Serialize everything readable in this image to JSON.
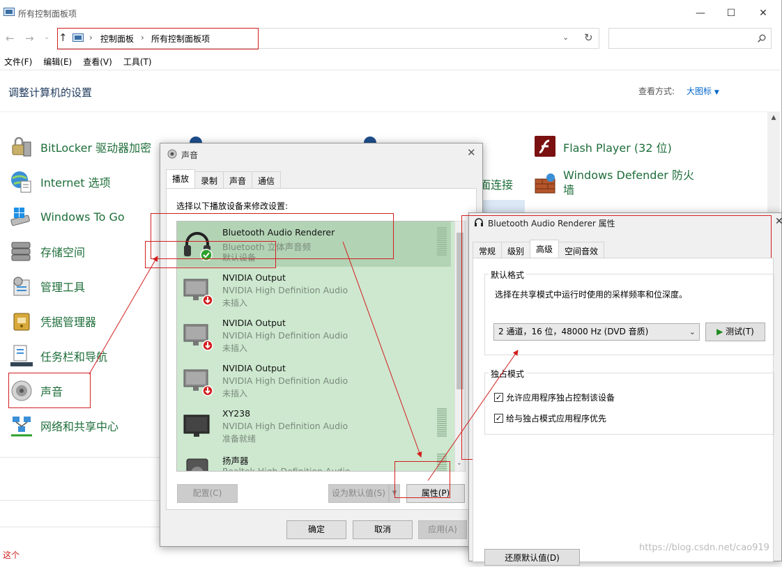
{
  "control_panel": {
    "window_title": "所有控制面板项",
    "breadcrumb": [
      "控制面板",
      "所有控制面板项"
    ],
    "menu": [
      "文件(F)",
      "编辑(E)",
      "查看(V)",
      "工具(T)"
    ],
    "heading": "调整计算机的设置",
    "view_by_label": "查看方式:",
    "view_by_value": "大图标",
    "items_left": [
      {
        "label": "BitLocker 驱动器加密",
        "icon": "bitlocker-icon"
      },
      {
        "label": "Internet 选项",
        "icon": "internet-options-icon"
      },
      {
        "label": "Windows To Go",
        "icon": "windows-to-go-icon"
      },
      {
        "label": "存储空间",
        "icon": "storage-spaces-icon"
      },
      {
        "label": "管理工具",
        "icon": "admin-tools-icon"
      },
      {
        "label": "凭据管理器",
        "icon": "credential-manager-icon"
      },
      {
        "label": "任务栏和导航",
        "icon": "taskbar-icon"
      },
      {
        "label": "声音",
        "icon": "sound-icon"
      },
      {
        "label": "网络和共享中心",
        "icon": "network-icon"
      }
    ],
    "items_right": [
      {
        "label": "Flash Player (32 位)",
        "icon": "flash-player-icon"
      },
      {
        "label": "Windows Defender 防火\n墙",
        "icon": "firewall-icon"
      }
    ],
    "partial_item": "面连接",
    "bottom_text": "这个"
  },
  "sound_dialog": {
    "title": "声音",
    "tabs": [
      "播放",
      "录制",
      "声音",
      "通信"
    ],
    "instruction": "选择以下播放设备来修改设置:",
    "devices": [
      {
        "name": "Bluetooth Audio Renderer",
        "desc": "Bluetooth 立体声音频",
        "status": "默认设备",
        "icon": "headphones-icon",
        "badge": "default-check"
      },
      {
        "name": "NVIDIA Output",
        "desc": "NVIDIA High Definition Audio",
        "status": "未插入",
        "icon": "monitor-icon",
        "badge": "unplugged"
      },
      {
        "name": "NVIDIA Output",
        "desc": "NVIDIA High Definition Audio",
        "status": "未插入",
        "icon": "monitor-icon",
        "badge": "unplugged"
      },
      {
        "name": "NVIDIA Output",
        "desc": "NVIDIA High Definition Audio",
        "status": "未插入",
        "icon": "monitor-icon",
        "badge": "unplugged"
      },
      {
        "name": "XY238",
        "desc": "NVIDIA High Definition Audio",
        "status": "准备就绪",
        "icon": "monitor-icon",
        "badge": ""
      },
      {
        "name": "扬声器",
        "desc": "Realtek High Definition Audio",
        "status": "",
        "icon": "speaker-icon",
        "badge": ""
      }
    ],
    "buttons": {
      "configure": "配置(C)",
      "set_default": "设为默认值(S)",
      "properties": "属性(P)",
      "ok": "确定",
      "cancel": "取消",
      "apply": "应用(A)"
    }
  },
  "properties_dialog": {
    "title": "Bluetooth Audio Renderer 属性",
    "tabs": [
      "常规",
      "级别",
      "高级",
      "空间音效"
    ],
    "default_format_group": "默认格式",
    "default_format_desc": "选择在共享模式中运行时使用的采样频率和位深度。",
    "format_value": "2 通道，16 位，48000 Hz (DVD 音质)",
    "test_button": "测试(T)",
    "exclusive_group": "独占模式",
    "checkbox1": "允许应用程序独占控制该设备",
    "checkbox2": "给与独占模式应用程序优先",
    "restore_button": "还原默认值(D)"
  },
  "watermark": "https://blog.csdn.net/cao919",
  "colors": {
    "annotation_red": "#d21e1e",
    "link_blue": "#0066cc",
    "item_green": "#1e6e3a",
    "list_green": "#cde8cf"
  }
}
